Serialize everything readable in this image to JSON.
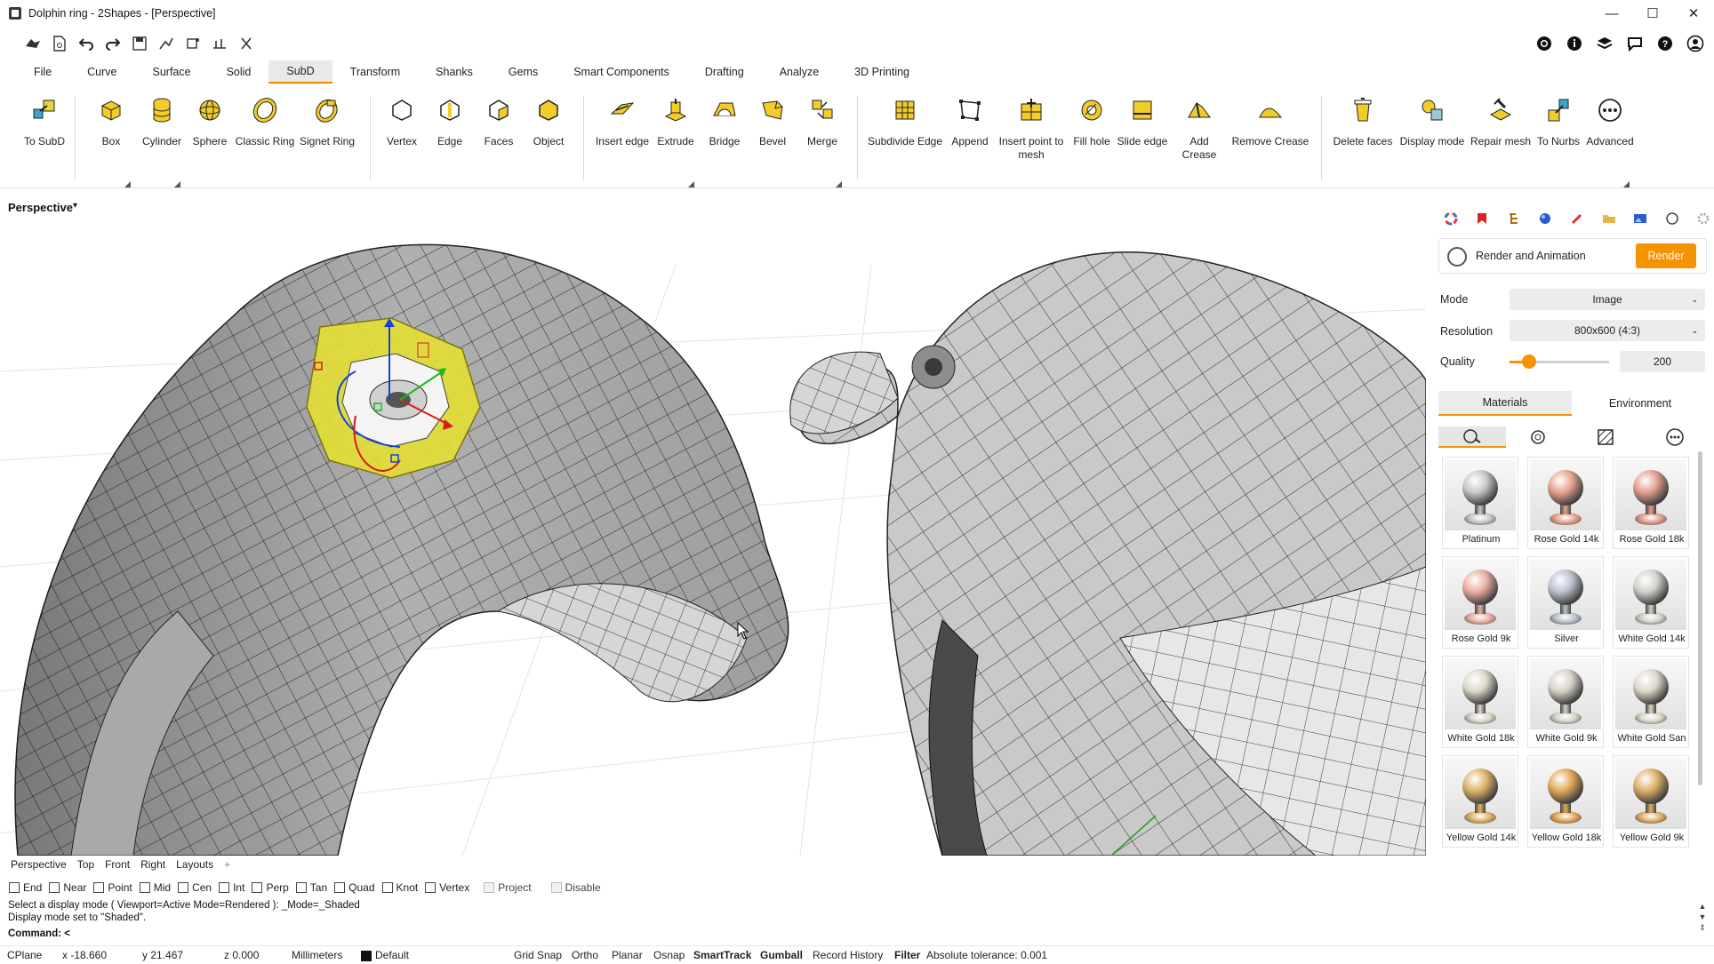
{
  "window": {
    "title": "Dolphin ring - 2Shapes - [Perspective]",
    "minimize": "—",
    "maximize": "☐",
    "close": "✕"
  },
  "quick_toolbar": {
    "left_icons": [
      "open-icon",
      "new-icon",
      "undo-icon",
      "redo-icon",
      "save-icon",
      "print-icon",
      "plugin-icon",
      "settings-icon",
      "options-icon"
    ],
    "right_icons": [
      "record-icon",
      "info-icon",
      "layers-icon",
      "chat-icon",
      "help-icon",
      "account-icon"
    ]
  },
  "tabs": [
    "File",
    "Curve",
    "Surface",
    "Solid",
    "SubD",
    "Transform",
    "Shanks",
    "Gems",
    "Smart Components",
    "Drafting",
    "Analyze",
    "3D Printing"
  ],
  "active_tab": "SubD",
  "ribbon": {
    "buttons": [
      {
        "label": "To SubD"
      },
      {
        "label": "Box"
      },
      {
        "label": "Cylinder"
      },
      {
        "label": "Sphere"
      },
      {
        "label": "Classic Ring"
      },
      {
        "label": "Signet Ring"
      },
      {
        "label": "Vertex"
      },
      {
        "label": "Edge"
      },
      {
        "label": "Faces"
      },
      {
        "label": "Object"
      },
      {
        "label": "Insert edge"
      },
      {
        "label": "Extrude"
      },
      {
        "label": "Bridge"
      },
      {
        "label": "Bevel"
      },
      {
        "label": "Merge"
      },
      {
        "label": "Subdivide Edge"
      },
      {
        "label": "Append"
      },
      {
        "label": "Insert point to mesh"
      },
      {
        "label": "Fill hole"
      },
      {
        "label": "Slide edge"
      },
      {
        "label": "Add Crease"
      },
      {
        "label": "Remove Crease"
      },
      {
        "label": "Delete faces"
      },
      {
        "label": "Display mode"
      },
      {
        "label": "Repair mesh"
      },
      {
        "label": "To Nurbs"
      },
      {
        "label": "Advanced"
      }
    ]
  },
  "viewport": {
    "label": "Perspective",
    "dropdown_arrow": "▾"
  },
  "panel": {
    "title": "Render and Animation",
    "render_button": "Render",
    "mode_label": "Mode",
    "mode_value": "Image",
    "resolution_label": "Resolution",
    "resolution_value": "800x600 (4:3)",
    "quality_label": "Quality",
    "quality_value": "200",
    "quality_level": 0.2,
    "tabs": [
      "Materials",
      "Environment"
    ],
    "active_tab": "Materials",
    "materials": [
      {
        "name": "Platinum",
        "color": "#c9c9c9"
      },
      {
        "name": "Rose Gold 14k",
        "color": "#e8a58e"
      },
      {
        "name": "Rose Gold 18k",
        "color": "#e3a08f"
      },
      {
        "name": "Rose Gold 9k",
        "color": "#eab0a2"
      },
      {
        "name": "Silver",
        "color": "#bcc3ce"
      },
      {
        "name": "White Gold 14k",
        "color": "#d2d2cc"
      },
      {
        "name": "White Gold 18k",
        "color": "#dcd7c8"
      },
      {
        "name": "White Gold 9k",
        "color": "#d6d3c8"
      },
      {
        "name": "White Gold San",
        "color": "#dcd8c9"
      },
      {
        "name": "Yellow Gold 14k",
        "color": "#e0b469"
      },
      {
        "name": "Yellow Gold 18k",
        "color": "#e3a95a"
      },
      {
        "name": "Yellow Gold 9k",
        "color": "#dfb06a"
      }
    ]
  },
  "layout_tabs": [
    "Perspective",
    "Top",
    "Front",
    "Right",
    "Layouts",
    "+"
  ],
  "osnaps": [
    {
      "label": "End",
      "enabled": true
    },
    {
      "label": "Near",
      "enabled": true
    },
    {
      "label": "Point",
      "enabled": true
    },
    {
      "label": "Mid",
      "enabled": true
    },
    {
      "label": "Cen",
      "enabled": true
    },
    {
      "label": "Int",
      "enabled": true
    },
    {
      "label": "Perp",
      "enabled": true
    },
    {
      "label": "Tan",
      "enabled": true
    },
    {
      "label": "Quad",
      "enabled": true
    },
    {
      "label": "Knot",
      "enabled": true
    },
    {
      "label": "Vertex",
      "enabled": true
    },
    {
      "label": "Project",
      "enabled": false
    },
    {
      "label": "Disable",
      "enabled": false
    }
  ],
  "command_history": [
    "Select a display mode ( Viewport=Active  Mode=Rendered ): _Mode=_Shaded",
    "Display mode set to \"Shaded\"."
  ],
  "command_prompt": "Command: <",
  "status": {
    "cplane": "CPlane",
    "x": "x -18.660",
    "y": "y 21.467",
    "z": "z 0.000",
    "units": "Millimeters",
    "layer": "Default",
    "grid_snap": "Grid Snap",
    "ortho": "Ortho",
    "planar": "Planar",
    "osnap": "Osnap",
    "smarttrack": "SmartTrack",
    "gumball": "Gumball",
    "record_history": "Record History",
    "filter": "Filter",
    "tolerance": "Absolute tolerance: 0.001"
  },
  "colors": {
    "accent": "#f59300",
    "active_tab_underline": "#f08a00",
    "mesh_gray": "#9a9a9a",
    "selection_yellow": "#e3df34"
  }
}
